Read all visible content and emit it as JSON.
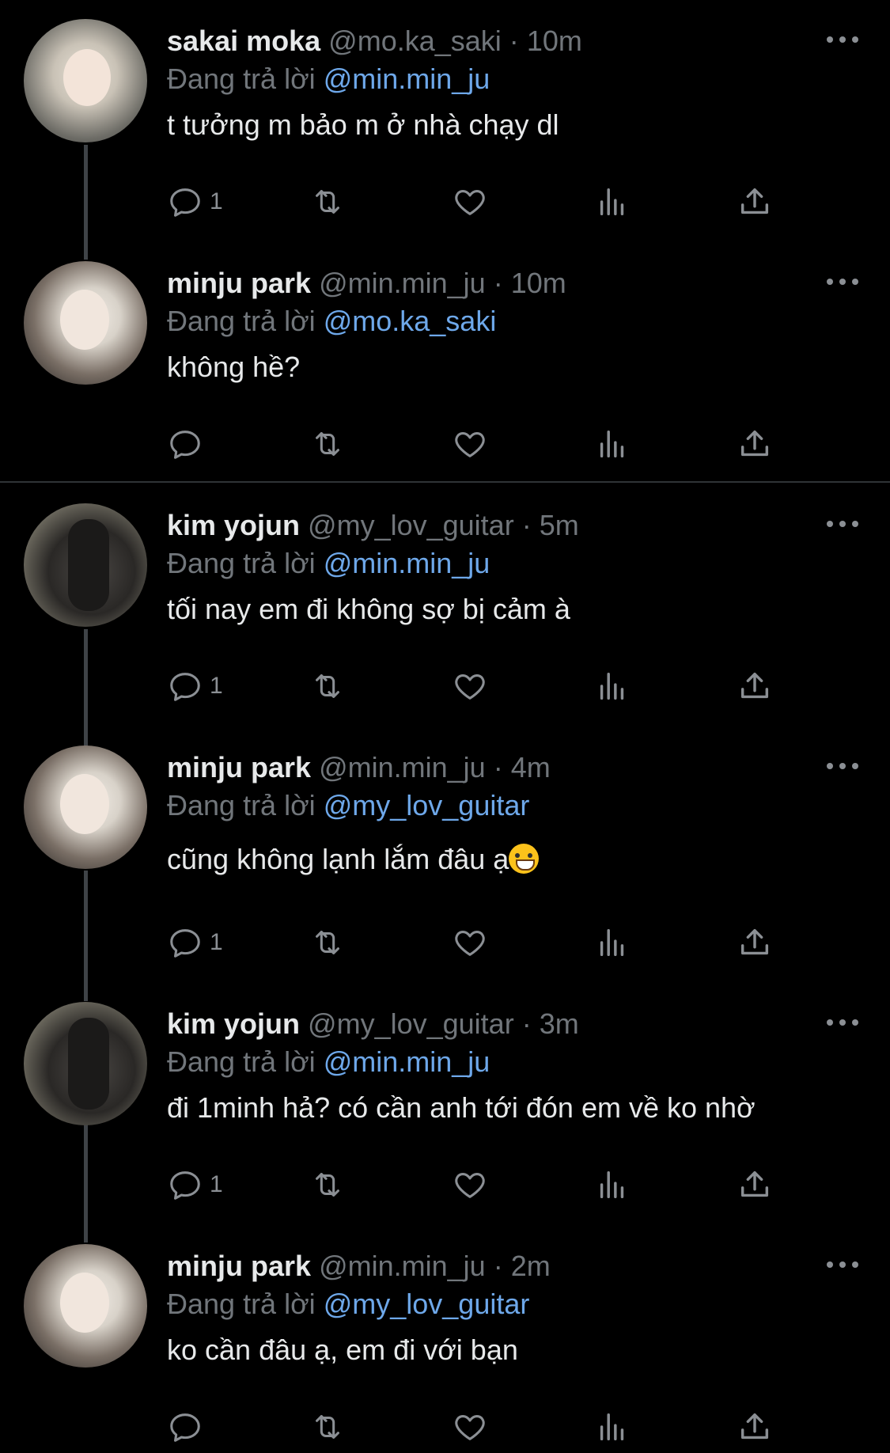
{
  "tweets": [
    {
      "name": "sakai moka",
      "handle": "@mo.ka_saki",
      "dot": "·",
      "time": "10m",
      "reply_prefix": "Đang trả lời",
      "reply_to": "@min.min_ju",
      "text": "t tưởng m bảo m ở nhà chạy dl",
      "reply_count": "1"
    },
    {
      "name": "minju park",
      "handle": "@min.min_ju",
      "dot": "·",
      "time": "10m",
      "reply_prefix": "Đang trả lời",
      "reply_to": "@mo.ka_saki",
      "text": "không hề?",
      "reply_count": ""
    },
    {
      "name": "kim yojun",
      "handle": "@my_lov_guitar",
      "dot": "·",
      "time": "5m",
      "reply_prefix": "Đang trả lời",
      "reply_to": "@min.min_ju",
      "text": "tối nay em đi không sợ bị cảm à",
      "reply_count": "1"
    },
    {
      "name": "minju park",
      "handle": "@min.min_ju",
      "dot": "·",
      "time": "4m",
      "reply_prefix": "Đang trả lời",
      "reply_to": "@my_lov_guitar",
      "text": "cũng không lạnh lắm đâu ạ",
      "reply_count": "1"
    },
    {
      "name": "kim yojun",
      "handle": "@my_lov_guitar",
      "dot": "·",
      "time": "3m",
      "reply_prefix": "Đang trả lời",
      "reply_to": "@min.min_ju",
      "text": "đi 1minh hả? có cần anh tới đón em về ko nhờ",
      "reply_count": "1"
    },
    {
      "name": "minju park",
      "handle": "@min.min_ju",
      "dot": "·",
      "time": "2m",
      "reply_prefix": "Đang trả lời",
      "reply_to": "@my_lov_guitar",
      "text": "ko cần đâu ạ, em đi với bạn",
      "reply_count": ""
    }
  ],
  "icons": [
    "reply-icon",
    "retweet-icon",
    "like-icon",
    "views-icon",
    "share-icon",
    "more-icon"
  ],
  "colors": {
    "background": "#000000",
    "mention": "#6ea8ea",
    "muted": "#71767b",
    "text": "#e7e9ea"
  }
}
